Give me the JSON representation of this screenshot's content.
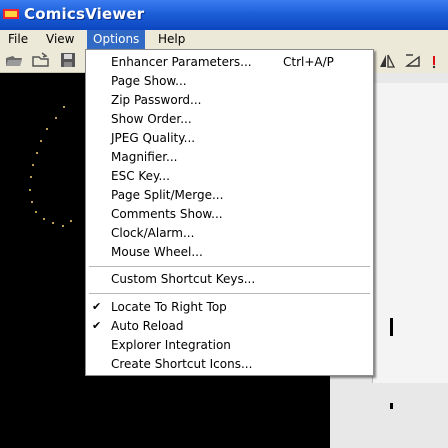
{
  "window": {
    "title": "ComicsViewer"
  },
  "menubar": {
    "file": "File",
    "view": "View",
    "options": "Options",
    "help": "Help"
  },
  "toolbar": {
    "buttons": [
      "open-icon",
      "open-folder-icon",
      "save-icon"
    ]
  },
  "options_menu": {
    "group1": [
      {
        "label": "Enhancer Parameters...",
        "accel": "Ctrl+A/P"
      },
      {
        "label": "Page Show..."
      },
      {
        "label": "Zip Password..."
      },
      {
        "label": "Show Order..."
      },
      {
        "label": "JPEG Quality..."
      },
      {
        "label": "Magnifier..."
      },
      {
        "label": "ESC Key..."
      },
      {
        "label": "Page Split/Merge..."
      },
      {
        "label": "Comments Show..."
      },
      {
        "label": "Clock/Alarm..."
      },
      {
        "label": "Mouse Wheel..."
      }
    ],
    "group2": [
      {
        "label": "Custom Shortcut Keys..."
      }
    ],
    "group3": [
      {
        "label": "Locate To Right Top",
        "checked": true
      },
      {
        "label": "Auto Reload",
        "checked": true
      },
      {
        "label": "Explorer Integration",
        "checked": false
      },
      {
        "label": "Create Shortcut Icons...",
        "checked": false
      }
    ]
  },
  "colors": {
    "titlebar": "#1d5fd8",
    "menu_highlight": "#316ac5",
    "background": "#000000"
  }
}
